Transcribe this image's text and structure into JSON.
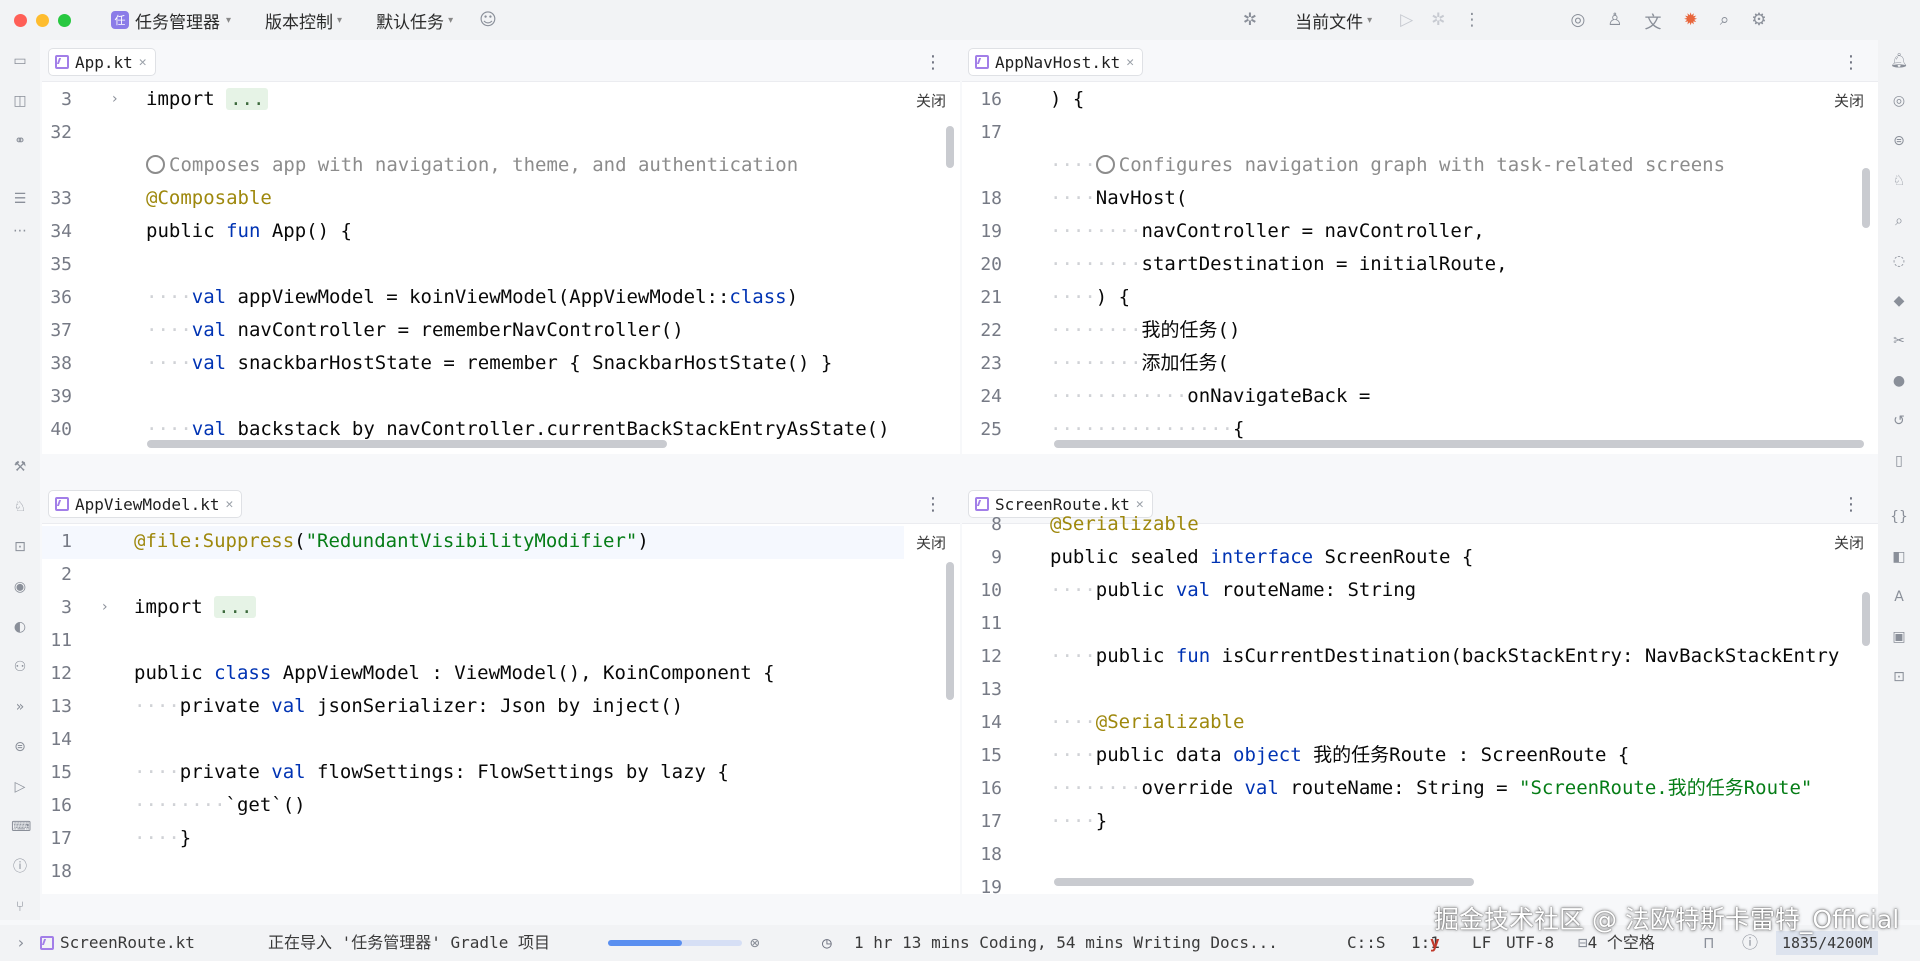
{
  "titlebar": {
    "project_badge": "任",
    "project_name": "任务管理器",
    "vcs": "版本控制",
    "task": "默认任务",
    "run_config": "当前文件"
  },
  "panes": {
    "top_left": {
      "tab": "App.kt",
      "close_label": "关闭",
      "lines": [
        {
          "n": "3",
          "html": "import <span class='fold-dots'>...</span>",
          "fold": true
        },
        {
          "n": "32",
          "html": ""
        },
        {
          "n": "",
          "html": "<span class='ai-icon'></span><span class='cmt'>Composes app with navigation, theme, and authentication</span>"
        },
        {
          "n": "33",
          "html": "<span class='ann'>@Composable</span>"
        },
        {
          "n": "34",
          "html": "public <span class='kw'>fun</span> App() {"
        },
        {
          "n": "35",
          "html": ""
        },
        {
          "n": "36",
          "html": "<span class='dots'>····</span><span class='kw'>val</span> appViewModel = koinViewModel(AppViewModel::<span class='kw'>class</span>)"
        },
        {
          "n": "37",
          "html": "<span class='dots'>····</span><span class='kw'>val</span> navController = rememberNavController()"
        },
        {
          "n": "38",
          "html": "<span class='dots'>····</span><span class='kw'>val</span> snackbarHostState = remember { SnackbarHostState() }"
        },
        {
          "n": "39",
          "html": ""
        },
        {
          "n": "40",
          "html": "<span class='dots'>····</span><span class='kw'>val</span> backstack by navController.currentBackStackEntryAsState()"
        }
      ]
    },
    "top_right": {
      "tab": "AppNavHost.kt",
      "close_label": "关闭",
      "lines": [
        {
          "n": "16",
          "html": ") {"
        },
        {
          "n": "17",
          "html": ""
        },
        {
          "n": "",
          "html": "<span class='dots'>····</span><span class='ai-icon'></span><span class='cmt'>Configures navigation graph with task-related screens</span>"
        },
        {
          "n": "18",
          "html": "<span class='dots'>····</span>NavHost("
        },
        {
          "n": "19",
          "html": "<span class='dots'>········</span>navController = navController,"
        },
        {
          "n": "20",
          "html": "<span class='dots'>········</span>startDestination = initialRoute,"
        },
        {
          "n": "21",
          "html": "<span class='dots'>····</span>) {"
        },
        {
          "n": "22",
          "html": "<span class='dots'>········</span>我的任务()"
        },
        {
          "n": "23",
          "html": "<span class='dots'>········</span>添加任务("
        },
        {
          "n": "24",
          "html": "<span class='dots'>············</span>onNavigateBack ="
        },
        {
          "n": "25",
          "html": "<span class='dots'>················</span>{"
        }
      ]
    },
    "bottom_left": {
      "tab": "AppViewModel.kt",
      "close_label": "关闭",
      "lines": [
        {
          "n": "1",
          "html": "<span class='ann'>@file:Suppress</span>(<span class='str'>\"RedundantVisibilityModifier\"</span>)"
        },
        {
          "n": "2",
          "html": ""
        },
        {
          "n": "3",
          "html": "import <span class='fold-dots'>...</span>",
          "fold": true
        },
        {
          "n": "11",
          "html": ""
        },
        {
          "n": "12",
          "html": "public <span class='kw'>class</span> AppViewModel : ViewModel(), KoinComponent {"
        },
        {
          "n": "13",
          "html": "<span class='dots'>····</span>private <span class='kw'>val</span> jsonSerializer: Json by inject()"
        },
        {
          "n": "14",
          "html": ""
        },
        {
          "n": "15",
          "html": "<span class='dots'>····</span>private <span class='kw'>val</span> flowSettings: FlowSettings by lazy {"
        },
        {
          "n": "16",
          "html": "<span class='dots'>········</span>`get`()"
        },
        {
          "n": "17",
          "html": "<span class='dots'>····</span>}"
        },
        {
          "n": "18",
          "html": ""
        }
      ]
    },
    "bottom_right": {
      "tab": "ScreenRoute.kt",
      "close_label": "关闭",
      "lines": [
        {
          "n": "8",
          "html": "<span class='ann'>@Serializable</span>"
        },
        {
          "n": "9",
          "html": "public sealed <span class='kw'>interface</span> ScreenRoute {"
        },
        {
          "n": "10",
          "html": "<span class='dots'>····</span>public <span class='kw'>val</span> routeName: String"
        },
        {
          "n": "11",
          "html": ""
        },
        {
          "n": "12",
          "html": "<span class='dots'>····</span>public <span class='kw'>fun</span> isCurrentDestination(backStackEntry: NavBackStackEntry"
        },
        {
          "n": "13",
          "html": ""
        },
        {
          "n": "14",
          "html": "<span class='dots'>····</span><span class='ann'>@Serializable</span>"
        },
        {
          "n": "15",
          "html": "<span class='dots'>····</span>public data <span class='kw'>object</span> 我的任务Route : ScreenRoute {"
        },
        {
          "n": "16",
          "html": "<span class='dots'>········</span>override <span class='kw'>val</span> routeName: String = <span class='str'>\"ScreenRoute.我的任务Route\"</span>"
        },
        {
          "n": "17",
          "html": "<span class='dots'>····</span>}"
        },
        {
          "n": "18",
          "html": ""
        },
        {
          "n": "19",
          "html": ""
        }
      ]
    }
  },
  "statusbar": {
    "breadcrumb": "ScreenRoute.kt",
    "import_status": "正在导入 '任务管理器' Gradle 项目",
    "import_progress": 0.55,
    "wakatime": "1 hr 13 mins Coding, 54 mins Writing Docs...",
    "caret_info": "C::S",
    "position": "1:1",
    "line_sep": "LF",
    "encoding": "UTF-8",
    "indent": "4 个空格",
    "memory": "1835/4200M"
  },
  "watermark": "掘金技术社区 @ 法欧特斯卡雷特_Official"
}
